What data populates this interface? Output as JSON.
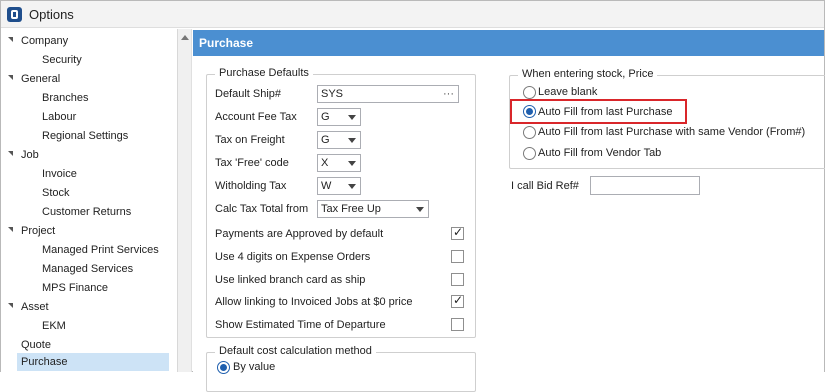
{
  "window": {
    "title": "Options"
  },
  "tree": {
    "items": [
      {
        "label": "Company",
        "collapsible": true
      },
      {
        "label": "Security",
        "collapsible": false
      },
      {
        "label": "General",
        "collapsible": true
      },
      {
        "label": "Branches",
        "collapsible": false
      },
      {
        "label": "Labour",
        "collapsible": false
      },
      {
        "label": "Regional Settings",
        "collapsible": false
      },
      {
        "label": "Job",
        "collapsible": true
      },
      {
        "label": "Invoice",
        "collapsible": false
      },
      {
        "label": "Stock",
        "collapsible": false
      },
      {
        "label": "Customer Returns",
        "collapsible": false
      },
      {
        "label": "Project",
        "collapsible": true
      },
      {
        "label": "Managed Print Services",
        "collapsible": false
      },
      {
        "label": "Managed Services",
        "collapsible": false
      },
      {
        "label": "MPS Finance",
        "collapsible": false
      },
      {
        "label": "Asset",
        "collapsible": true
      },
      {
        "label": "EKM",
        "collapsible": false
      },
      {
        "label": "Quote",
        "collapsible": false
      },
      {
        "label": "Purchase",
        "collapsible": false,
        "selected": true
      }
    ]
  },
  "header": {
    "title": "Purchase"
  },
  "purchase_defaults": {
    "legend": "Purchase Defaults",
    "default_ship_label": "Default Ship#",
    "default_ship_value": "SYS",
    "account_fee_tax_label": "Account Fee Tax",
    "account_fee_tax_value": "G",
    "tax_on_freight_label": "Tax on Freight",
    "tax_on_freight_value": "G",
    "tax_free_code_label": "Tax 'Free' code",
    "tax_free_code_value": "X",
    "witholding_tax_label": "Witholding Tax",
    "witholding_tax_value": "W",
    "calc_tax_total_label": "Calc Tax Total from",
    "calc_tax_total_value": "Tax Free Up",
    "checks": [
      {
        "label": "Payments are Approved by default",
        "checked": true
      },
      {
        "label": "Use 4 digits on Expense Orders",
        "checked": false
      },
      {
        "label": "Use linked branch card as ship",
        "checked": false
      },
      {
        "label": "Allow linking to Invoiced Jobs at $0 price",
        "checked": true
      },
      {
        "label": "Show Estimated Time of Departure",
        "checked": false
      }
    ]
  },
  "cost_calc": {
    "legend": "Default cost calculation method",
    "option_by_value": "By value"
  },
  "stock_price": {
    "legend": "When entering stock, Price",
    "options": [
      {
        "label": "Leave blank",
        "selected": false
      },
      {
        "label": "Auto Fill from last Purchase",
        "selected": true
      },
      {
        "label": "Auto Fill from last Purchase with same Vendor (From#)",
        "selected": false
      },
      {
        "label": "Auto Fill from Vendor Tab",
        "selected": false
      }
    ]
  },
  "bid_ref": {
    "label": "I call Bid Ref#",
    "value": ""
  },
  "icons": {
    "app": "app-logo-icon",
    "expand": "tree-expand-icon",
    "combo": "chevron-down-icon",
    "more": "ellipsis-icon"
  },
  "colors": {
    "header_bg": "#4b8fd1",
    "selection_bg": "#cde3f6",
    "highlight": "#d9262a"
  }
}
